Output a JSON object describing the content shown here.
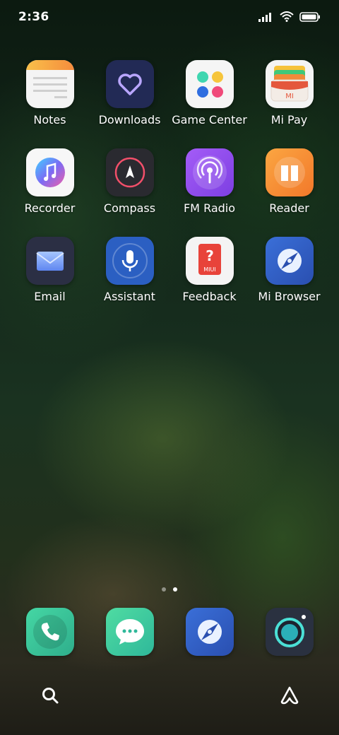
{
  "status": {
    "time": "2:36"
  },
  "apps": [
    {
      "label": "Notes"
    },
    {
      "label": "Downloads"
    },
    {
      "label": "Game Center"
    },
    {
      "label": "Mi Pay"
    },
    {
      "label": "Recorder"
    },
    {
      "label": "Compass"
    },
    {
      "label": "FM Radio"
    },
    {
      "label": "Reader"
    },
    {
      "label": "Email"
    },
    {
      "label": "Assistant"
    },
    {
      "label": "Feedback"
    },
    {
      "label": "Mi Browser"
    }
  ],
  "pages": {
    "count": 2,
    "active": 2
  },
  "dock": [
    {
      "icon": "phone-icon"
    },
    {
      "icon": "messaging-icon"
    },
    {
      "icon": "browser-icon"
    },
    {
      "icon": "camera-icon"
    }
  ],
  "bottom": {
    "left": "search-icon",
    "right": "app-vault-icon"
  },
  "colors": {
    "notes_top": "#f7a64a",
    "downloads_bg": "#222a55",
    "fm_bg": "#9b4cf0",
    "reader_bg": "#f58a2a",
    "assistant_bg": "#2b5fc2",
    "phone_bg": "#39c69a"
  }
}
